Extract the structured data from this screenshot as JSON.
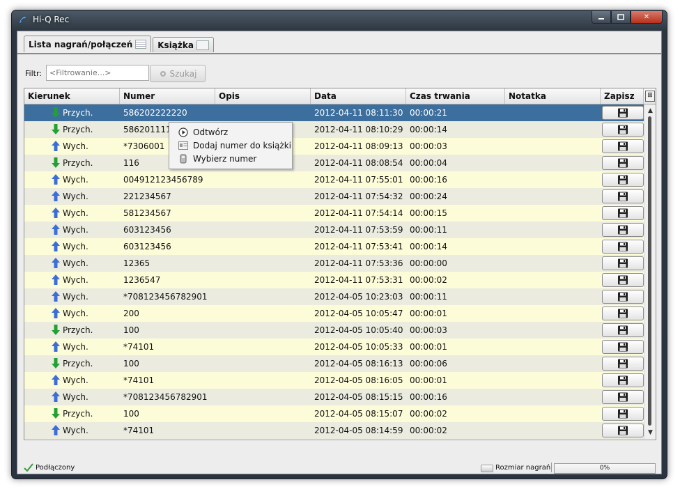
{
  "window": {
    "title": "Hi-Q Rec"
  },
  "tabs": [
    {
      "label": "Lista nagrań/połączeń"
    },
    {
      "label": "Książka"
    }
  ],
  "filter": {
    "label": "Filtr:",
    "placeholder": "<Filtrowanie...>",
    "search_label": "Szukaj"
  },
  "columns": [
    "Kierunek",
    "Numer",
    "Opis",
    "Data",
    "Czas trwania",
    "Notatka",
    "Zapisz"
  ],
  "rows": [
    {
      "dir": "Przych.",
      "type": "in",
      "number": "586202222220",
      "date": "2012-04-11 08:11:30",
      "duration": "00:00:21"
    },
    {
      "dir": "Przych.",
      "type": "in",
      "number": "586201111",
      "date": "2012-04-11 08:10:29",
      "duration": "00:00:14"
    },
    {
      "dir": "Wych.",
      "type": "out",
      "number": "*7306001",
      "date": "2012-04-11 08:09:13",
      "duration": "00:00:03"
    },
    {
      "dir": "Przych.",
      "type": "in",
      "number": "116",
      "date": "2012-04-11 08:08:54",
      "duration": "00:00:04"
    },
    {
      "dir": "Wych.",
      "type": "out",
      "number": "004912123456789",
      "date": "2012-04-11 07:55:01",
      "duration": "00:00:16"
    },
    {
      "dir": "Wych.",
      "type": "out",
      "number": "221234567",
      "date": "2012-04-11 07:54:32",
      "duration": "00:00:24"
    },
    {
      "dir": "Wych.",
      "type": "out",
      "number": "581234567",
      "date": "2012-04-11 07:54:14",
      "duration": "00:00:15"
    },
    {
      "dir": "Wych.",
      "type": "out",
      "number": "603123456",
      "date": "2012-04-11 07:53:59",
      "duration": "00:00:11"
    },
    {
      "dir": "Wych.",
      "type": "out",
      "number": "603123456",
      "date": "2012-04-11 07:53:41",
      "duration": "00:00:14"
    },
    {
      "dir": "Wych.",
      "type": "out",
      "number": "12365",
      "date": "2012-04-11 07:53:36",
      "duration": "00:00:00"
    },
    {
      "dir": "Wych.",
      "type": "out",
      "number": "1236547",
      "date": "2012-04-11 07:53:31",
      "duration": "00:00:02"
    },
    {
      "dir": "Wych.",
      "type": "out",
      "number": "*708123456782901",
      "date": "2012-04-05 10:23:03",
      "duration": "00:00:11"
    },
    {
      "dir": "Wych.",
      "type": "out",
      "number": "200",
      "date": "2012-04-05 10:05:47",
      "duration": "00:00:01"
    },
    {
      "dir": "Przych.",
      "type": "in",
      "number": "100",
      "date": "2012-04-05 10:05:40",
      "duration": "00:00:03"
    },
    {
      "dir": "Wych.",
      "type": "out",
      "number": "*74101",
      "date": "2012-04-05 10:05:33",
      "duration": "00:00:01"
    },
    {
      "dir": "Przych.",
      "type": "in",
      "number": "100",
      "date": "2012-04-05 08:16:13",
      "duration": "00:00:06"
    },
    {
      "dir": "Wych.",
      "type": "out",
      "number": "*74101",
      "date": "2012-04-05 08:16:05",
      "duration": "00:00:01"
    },
    {
      "dir": "Wych.",
      "type": "out",
      "number": "*708123456782901",
      "date": "2012-04-05 08:15:15",
      "duration": "00:00:16"
    },
    {
      "dir": "Przych.",
      "type": "in",
      "number": "100",
      "date": "2012-04-05 08:15:07",
      "duration": "00:00:02"
    },
    {
      "dir": "Wych.",
      "type": "out",
      "number": "*74101",
      "date": "2012-04-05 08:14:59",
      "duration": "00:00:02"
    }
  ],
  "context_menu": [
    {
      "label": "Odtwórz",
      "icon": "play-icon"
    },
    {
      "label": "Dodaj numer do książki",
      "icon": "address-book-icon"
    },
    {
      "label": "Wybierz numer",
      "icon": "phone-icon"
    }
  ],
  "status": {
    "connection": "Podłączony",
    "recording_size_label": "Rozmiar nagrań",
    "recording_size_value": "0%"
  },
  "colors": {
    "in_arrow": "#22a033",
    "out_arrow": "#3c6fd6",
    "selected_row": "#3d6f9e",
    "row_odd": "#fdfcd8",
    "row_even": "#ecebe0"
  }
}
